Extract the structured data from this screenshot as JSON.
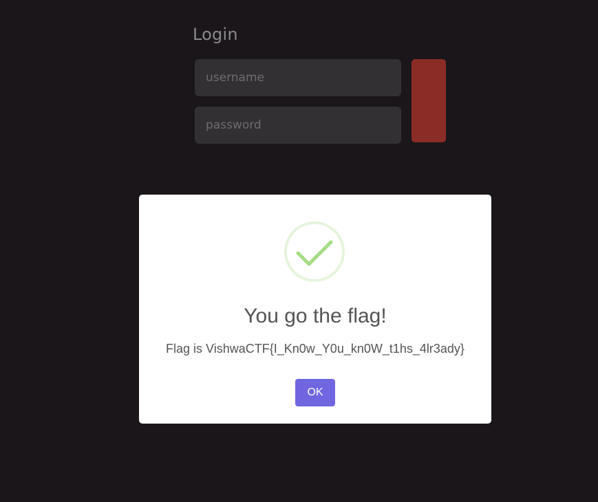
{
  "login": {
    "title": "Login",
    "username_placeholder": "username",
    "password_placeholder": "password",
    "submit_color": "#8c2c27"
  },
  "dialog": {
    "icon": "success-check-icon",
    "title": "You go the flag!",
    "text": "Flag is VishwaCTF{I_Kn0w_Y0u_kn0W_t1hs_4lr3ady}",
    "ok_label": "OK",
    "accent_color": "#7066e0",
    "icon_color": "#a5dc86"
  }
}
